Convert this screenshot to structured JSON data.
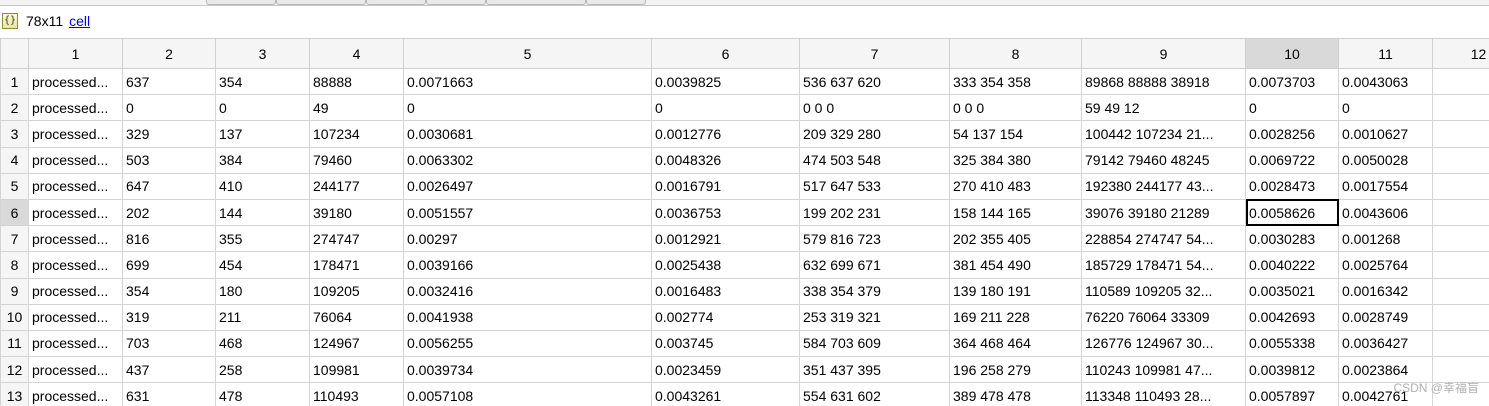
{
  "info": {
    "icon": "cell-array-icon",
    "icon_glyph": "{}",
    "dimensions": "78x11",
    "type": "cell"
  },
  "columns": [
    "1",
    "2",
    "3",
    "4",
    "5",
    "6",
    "7",
    "8",
    "9",
    "10",
    "11",
    "12"
  ],
  "selected_column": "10",
  "selected_row": "6",
  "rows": [
    {
      "n": "1",
      "cells": [
        "processed...",
        "637",
        "354",
        "88888",
        "0.0071663",
        "0.0039825",
        "536  637  620",
        "333  354  358",
        "89868  88888  38918",
        "0.0073703",
        "0.0043063",
        ""
      ]
    },
    {
      "n": "2",
      "cells": [
        "processed...",
        "0",
        "0",
        "49",
        "0",
        "0",
        "0  0  0",
        "0  0  0",
        "59  49  12",
        "0",
        "0",
        ""
      ]
    },
    {
      "n": "3",
      "cells": [
        "processed...",
        "329",
        "137",
        "107234",
        "0.0030681",
        "0.0012776",
        "209  329  280",
        "54  137  154",
        "100442  107234  21...",
        "0.0028256",
        "0.0010627",
        ""
      ]
    },
    {
      "n": "4",
      "cells": [
        "processed...",
        "503",
        "384",
        "79460",
        "0.0063302",
        "0.0048326",
        "474  503  548",
        "325  384  380",
        "79142  79460  48245",
        "0.0069722",
        "0.0050028",
        ""
      ]
    },
    {
      "n": "5",
      "cells": [
        "processed...",
        "647",
        "410",
        "244177",
        "0.0026497",
        "0.0016791",
        "517  647  533",
        "270  410  483",
        "192380  244177  43...",
        "0.0028473",
        "0.0017554",
        ""
      ]
    },
    {
      "n": "6",
      "cells": [
        "processed...",
        "202",
        "144",
        "39180",
        "0.0051557",
        "0.0036753",
        "199  202  231",
        "158  144  165",
        "39076  39180  21289",
        "0.0058626",
        "0.0043606",
        ""
      ]
    },
    {
      "n": "7",
      "cells": [
        "processed...",
        "816",
        "355",
        "274747",
        "0.00297",
        "0.0012921",
        "579  816  723",
        "202  355  405",
        "228854  274747  54...",
        "0.0030283",
        "0.001268",
        ""
      ]
    },
    {
      "n": "8",
      "cells": [
        "processed...",
        "699",
        "454",
        "178471",
        "0.0039166",
        "0.0025438",
        "632  699  671",
        "381  454  490",
        "185729  178471  54...",
        "0.0040222",
        "0.0025764",
        ""
      ]
    },
    {
      "n": "9",
      "cells": [
        "processed...",
        "354",
        "180",
        "109205",
        "0.0032416",
        "0.0016483",
        "338  354  379",
        "139  180  191",
        "110589  109205  32...",
        "0.0035021",
        "0.0016342",
        ""
      ]
    },
    {
      "n": "10",
      "cells": [
        "processed...",
        "319",
        "211",
        "76064",
        "0.0041938",
        "0.002774",
        "253  319  321",
        "169  211  228",
        "76220  76064  33309",
        "0.0042693",
        "0.0028749",
        ""
      ]
    },
    {
      "n": "11",
      "cells": [
        "processed...",
        "703",
        "468",
        "124967",
        "0.0056255",
        "0.003745",
        "584  703  609",
        "364  468  464",
        "126776  124967  30...",
        "0.0055338",
        "0.0036427",
        ""
      ]
    },
    {
      "n": "12",
      "cells": [
        "processed...",
        "437",
        "258",
        "109981",
        "0.0039734",
        "0.0023459",
        "351  437  395",
        "196  258  279",
        "110243  109981  47...",
        "0.0039812",
        "0.0023864",
        ""
      ]
    },
    {
      "n": "13",
      "cells": [
        "processed...",
        "631",
        "478",
        "110493",
        "0.0057108",
        "0.0043261",
        "554  631  602",
        "389  478  478",
        "113348  110493  28...",
        "0.0057897",
        "0.0042761",
        ""
      ]
    }
  ],
  "watermark": "CSDN @幸福盲"
}
